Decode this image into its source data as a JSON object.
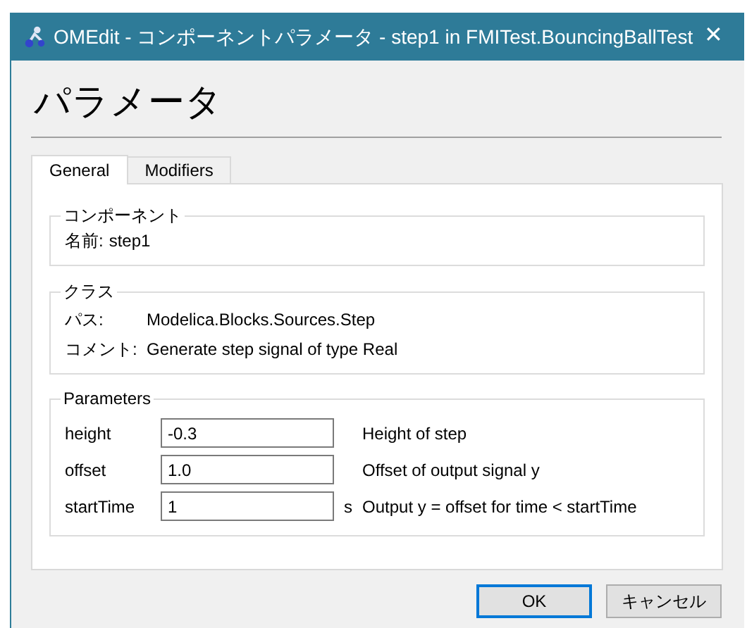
{
  "window": {
    "title": "OMEdit - コンポーネントパラメータ - step1 in FMITest.BouncingBallTest",
    "close": "✕"
  },
  "heading": "パラメータ",
  "tabs": [
    {
      "label": "General",
      "selected": true
    },
    {
      "label": "Modifiers",
      "selected": false
    }
  ],
  "component_group": {
    "title": "コンポーネント",
    "name_label": "名前:",
    "name_value": "step1"
  },
  "class_group": {
    "title": "クラス",
    "rows": [
      {
        "label": "パス:",
        "value": "Modelica.Blocks.Sources.Step"
      },
      {
        "label": "コメント:",
        "value": "Generate step signal of type Real"
      }
    ]
  },
  "parameters_group": {
    "title": "Parameters",
    "rows": [
      {
        "name": "height",
        "value": "-0.3",
        "description": "Height of step"
      },
      {
        "name": "offset",
        "value": "1.0",
        "description": "Offset of output signal y"
      },
      {
        "name": "startTime",
        "value": "1",
        "unit": "s",
        "description": "Output y = offset for time < startTime"
      }
    ]
  },
  "buttons": [
    {
      "label": "OK",
      "default": true
    },
    {
      "label": "キャンセル",
      "default": false
    }
  ]
}
